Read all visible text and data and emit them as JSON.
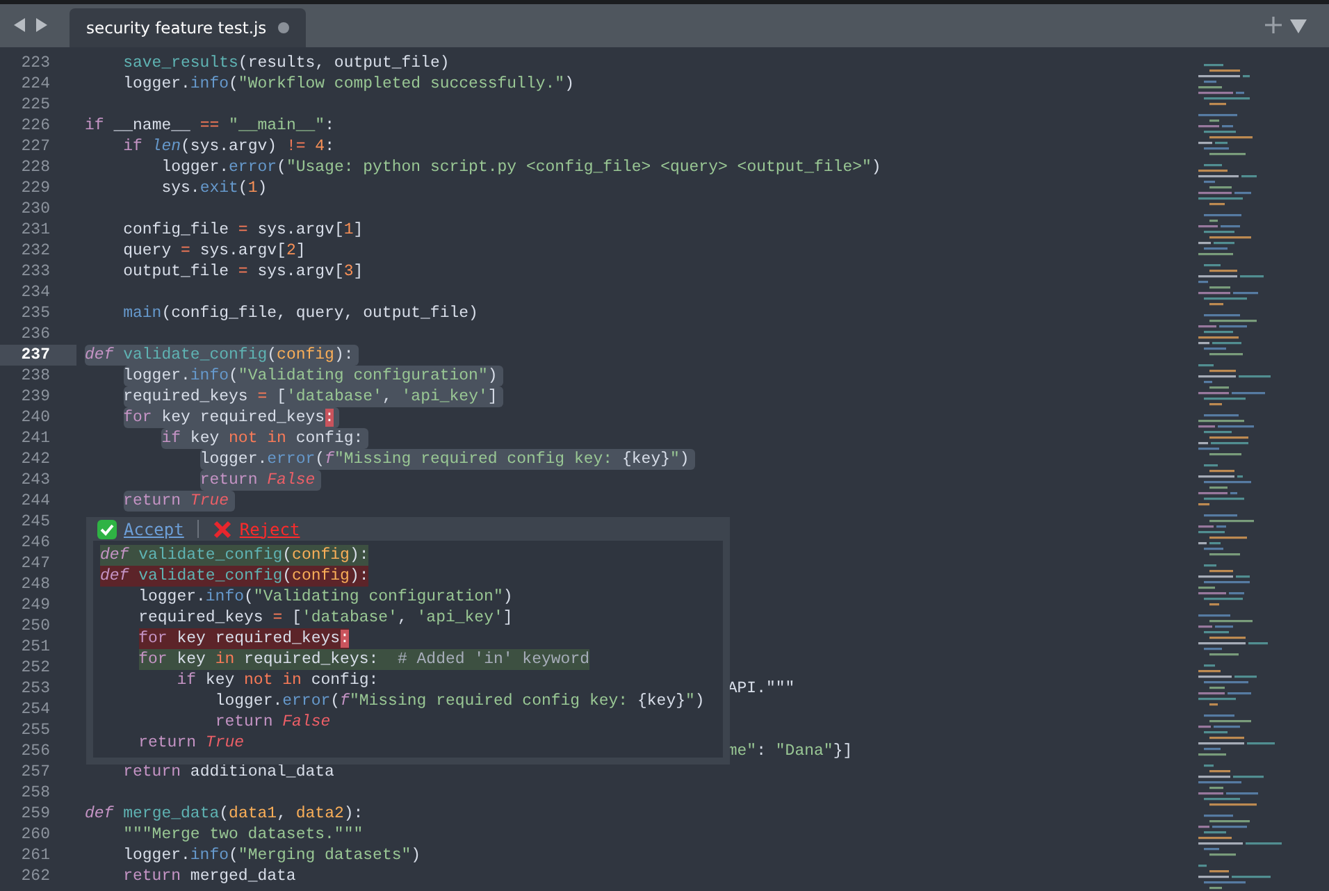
{
  "tabs": [
    {
      "title": "security feature test.js",
      "selected": true,
      "modified": true
    }
  ],
  "lines": [
    {
      "number": "223",
      "tokens": [
        {
          "kind": "fn",
          "text": "    save_results"
        },
        {
          "kind": "p",
          "text": "(results, output_file)"
        }
      ]
    },
    {
      "number": "224",
      "tokens": [
        {
          "kind": "p",
          "text": "    logger."
        },
        {
          "kind": "m",
          "text": "info"
        },
        {
          "kind": "p",
          "text": "("
        },
        {
          "kind": "s",
          "text": "\"Workflow completed successfully.\""
        },
        {
          "kind": "p",
          "text": ")"
        }
      ]
    },
    {
      "number": "225"
    },
    {
      "number": "226",
      "tokens": [
        {
          "kind": "kw",
          "text": "if"
        },
        {
          "kind": "p",
          "text": " __name__ "
        },
        {
          "kind": "op",
          "text": "=="
        },
        {
          "kind": "s",
          "text": " \"__main__\""
        },
        {
          "kind": "p",
          "text": ":"
        }
      ]
    },
    {
      "number": "227",
      "tokens": [
        {
          "kind": "kw",
          "text": "    if"
        },
        {
          "kind": "mi",
          "text": " len"
        },
        {
          "kind": "p",
          "text": "(sys.argv) "
        },
        {
          "kind": "op",
          "text": "!="
        },
        {
          "kind": "n",
          "text": " 4"
        },
        {
          "kind": "p",
          "text": ":"
        }
      ]
    },
    {
      "number": "228",
      "tokens": [
        {
          "kind": "p",
          "text": "        logger."
        },
        {
          "kind": "m",
          "text": "error"
        },
        {
          "kind": "p",
          "text": "("
        },
        {
          "kind": "s",
          "text": "\"Usage: python script.py <config_file> <query> <output_file>\""
        },
        {
          "kind": "p",
          "text": ")"
        }
      ]
    },
    {
      "number": "229",
      "tokens": [
        {
          "kind": "p",
          "text": "        sys."
        },
        {
          "kind": "m",
          "text": "exit"
        },
        {
          "kind": "p",
          "text": "("
        },
        {
          "kind": "n",
          "text": "1"
        },
        {
          "kind": "p",
          "text": ")"
        }
      ]
    },
    {
      "number": "230"
    },
    {
      "number": "231",
      "tokens": [
        {
          "kind": "p",
          "text": "    config_file "
        },
        {
          "kind": "op",
          "text": "="
        },
        {
          "kind": "p",
          "text": " sys.argv["
        },
        {
          "kind": "n",
          "text": "1"
        },
        {
          "kind": "p",
          "text": "]"
        }
      ]
    },
    {
      "number": "232",
      "tokens": [
        {
          "kind": "p",
          "text": "    query "
        },
        {
          "kind": "op",
          "text": "="
        },
        {
          "kind": "p",
          "text": " sys.argv["
        },
        {
          "kind": "n",
          "text": "2"
        },
        {
          "kind": "p",
          "text": "]"
        }
      ]
    },
    {
      "number": "233",
      "tokens": [
        {
          "kind": "p",
          "text": "    output_file "
        },
        {
          "kind": "op",
          "text": "="
        },
        {
          "kind": "p",
          "text": " sys.argv["
        },
        {
          "kind": "n",
          "text": "3"
        },
        {
          "kind": "p",
          "text": "]"
        }
      ]
    },
    {
      "number": "234"
    },
    {
      "number": "235",
      "tokens": [
        {
          "kind": "m",
          "text": "    main"
        },
        {
          "kind": "p",
          "text": "(config_file, query, output_file)"
        }
      ]
    },
    {
      "number": "236"
    },
    {
      "number": "237",
      "current": true,
      "selected": true,
      "tokens": [
        {
          "kind": "def",
          "text": "def"
        },
        {
          "kind": "fn",
          "text": " validate_config"
        },
        {
          "kind": "p",
          "text": "("
        },
        {
          "kind": "arg",
          "text": "config"
        },
        {
          "kind": "p",
          "text": "):"
        }
      ]
    },
    {
      "number": "238",
      "selected": true,
      "tokens": [
        {
          "kind": "p",
          "text": "    logger."
        },
        {
          "kind": "m",
          "text": "info"
        },
        {
          "kind": "p",
          "text": "("
        },
        {
          "kind": "s",
          "text": "\"Validating configuration\""
        },
        {
          "kind": "p",
          "text": ")"
        }
      ]
    },
    {
      "number": "239",
      "selected": true,
      "tokens": [
        {
          "kind": "p",
          "text": "    required_keys "
        },
        {
          "kind": "op",
          "text": "="
        },
        {
          "kind": "p",
          "text": " ["
        },
        {
          "kind": "s",
          "text": "'database'"
        },
        {
          "kind": "p",
          "text": ", "
        },
        {
          "kind": "s",
          "text": "'api_key'"
        },
        {
          "kind": "p",
          "text": "]"
        }
      ]
    },
    {
      "number": "240",
      "selected": true,
      "tokens": [
        {
          "kind": "kw",
          "text": "    for"
        },
        {
          "kind": "p",
          "text": " key required_keys"
        },
        {
          "kind": "err",
          "text": ":"
        }
      ]
    },
    {
      "number": "241",
      "selected": true,
      "tokens": [
        {
          "kind": "kw",
          "text": "        if"
        },
        {
          "kind": "p",
          "text": " key "
        },
        {
          "kind": "op",
          "text": "not in"
        },
        {
          "kind": "p",
          "text": " config:"
        }
      ]
    },
    {
      "number": "242",
      "selected": true,
      "tokens": [
        {
          "kind": "p",
          "text": "            logger."
        },
        {
          "kind": "m",
          "text": "error"
        },
        {
          "kind": "p",
          "text": "("
        },
        {
          "kind": "fp",
          "text": "f"
        },
        {
          "kind": "s",
          "text": "\"Missing required config key: "
        },
        {
          "kind": "p",
          "text": "{key}"
        },
        {
          "kind": "s",
          "text": "\""
        },
        {
          "kind": "p",
          "text": ")"
        }
      ]
    },
    {
      "number": "243",
      "selected": true,
      "tokens": [
        {
          "kind": "kw",
          "text": "            return"
        },
        {
          "kind": "c",
          "text": " False"
        }
      ]
    },
    {
      "number": "244",
      "selected": true,
      "tokens": [
        {
          "kind": "kw",
          "text": "    return"
        },
        {
          "kind": "c",
          "text": " True"
        }
      ]
    },
    {
      "number": "245"
    },
    {
      "number": "246"
    },
    {
      "number": "247"
    },
    {
      "number": "248"
    },
    {
      "number": "249"
    },
    {
      "number": "250"
    },
    {
      "number": "251"
    },
    {
      "number": "252"
    },
    {
      "number": "253",
      "tokens": [
        {
          "kind": "p",
          "text": "                                                                   API.\"\"\""
        }
      ]
    },
    {
      "number": "254"
    },
    {
      "number": "255"
    },
    {
      "number": "256",
      "tokens": [
        {
          "kind": "s",
          "text": "                                                                   me\""
        },
        {
          "kind": "p",
          "text": ": "
        },
        {
          "kind": "s",
          "text": "\"Dana\""
        },
        {
          "kind": "p",
          "text": "}]"
        }
      ]
    },
    {
      "number": "257",
      "tokens": [
        {
          "kind": "kw",
          "text": "    return"
        },
        {
          "kind": "p",
          "text": " additional_data"
        }
      ]
    },
    {
      "number": "258"
    },
    {
      "number": "259",
      "tokens": [
        {
          "kind": "def",
          "text": "def"
        },
        {
          "kind": "fn",
          "text": " merge_data"
        },
        {
          "kind": "p",
          "text": "("
        },
        {
          "kind": "arg",
          "text": "data1"
        },
        {
          "kind": "p",
          "text": ", "
        },
        {
          "kind": "arg",
          "text": "data2"
        },
        {
          "kind": "p",
          "text": "):"
        }
      ]
    },
    {
      "number": "260",
      "tokens": [
        {
          "kind": "s",
          "text": "    \"\"\"Merge two datasets.\"\"\""
        }
      ]
    },
    {
      "number": "261",
      "tokens": [
        {
          "kind": "p",
          "text": "    logger."
        },
        {
          "kind": "m",
          "text": "info"
        },
        {
          "kind": "p",
          "text": "("
        },
        {
          "kind": "s",
          "text": "\"Merging datasets\""
        },
        {
          "kind": "p",
          "text": ")"
        }
      ]
    },
    {
      "number": "262",
      "tokens": [
        {
          "kind": "kw",
          "text": "    return"
        },
        {
          "kind": "p",
          "text": " merged_data"
        }
      ]
    }
  ],
  "diff_popup": {
    "actions": [
      {
        "kind": "accept",
        "label": "Accept"
      },
      {
        "kind": "reject",
        "label": "Reject"
      }
    ],
    "lines": [
      {
        "kind": "added",
        "tokens": [
          {
            "kind": "def",
            "text": "def"
          },
          {
            "kind": "fn",
            "text": " validate_config"
          },
          {
            "kind": "p",
            "text": "("
          },
          {
            "kind": "arg",
            "text": "config"
          },
          {
            "kind": "p",
            "text": "):"
          }
        ]
      },
      {
        "kind": "removed",
        "tokens": [
          {
            "kind": "def",
            "text": "def"
          },
          {
            "kind": "fn",
            "text": " validate_config"
          },
          {
            "kind": "p",
            "text": "("
          },
          {
            "kind": "arg",
            "text": "config"
          },
          {
            "kind": "p",
            "text": "):"
          }
        ]
      },
      {
        "kind": "normal",
        "tokens": [
          {
            "kind": "p",
            "text": "    logger."
          },
          {
            "kind": "m",
            "text": "info"
          },
          {
            "kind": "p",
            "text": "("
          },
          {
            "kind": "s",
            "text": "\"Validating configuration\""
          },
          {
            "kind": "p",
            "text": ")"
          }
        ]
      },
      {
        "kind": "normal",
        "tokens": [
          {
            "kind": "p",
            "text": "    required_keys "
          },
          {
            "kind": "op",
            "text": "="
          },
          {
            "kind": "p",
            "text": " ["
          },
          {
            "kind": "s",
            "text": "'database'"
          },
          {
            "kind": "p",
            "text": ", "
          },
          {
            "kind": "s",
            "text": "'api_key'"
          },
          {
            "kind": "p",
            "text": "]"
          }
        ]
      },
      {
        "kind": "removed",
        "tokens": [
          {
            "kind": "kw",
            "text": "    for"
          },
          {
            "kind": "p",
            "text": " key required_keys"
          },
          {
            "kind": "err",
            "text": ":"
          }
        ]
      },
      {
        "kind": "added",
        "tokens": [
          {
            "kind": "kw",
            "text": "    for"
          },
          {
            "kind": "p",
            "text": " key "
          },
          {
            "kind": "op",
            "text": "in"
          },
          {
            "kind": "p",
            "text": " required_keys:  "
          },
          {
            "kind": "cm",
            "text": "# Added 'in' keyword"
          }
        ]
      },
      {
        "kind": "normal",
        "tokens": [
          {
            "kind": "kw",
            "text": "        if"
          },
          {
            "kind": "p",
            "text": " key "
          },
          {
            "kind": "op",
            "text": "not in"
          },
          {
            "kind": "p",
            "text": " config:"
          }
        ]
      },
      {
        "kind": "normal",
        "tokens": [
          {
            "kind": "p",
            "text": "            logger."
          },
          {
            "kind": "m",
            "text": "error"
          },
          {
            "kind": "p",
            "text": "("
          },
          {
            "kind": "fp",
            "text": "f"
          },
          {
            "kind": "s",
            "text": "\"Missing required config key: "
          },
          {
            "kind": "p",
            "text": "{key}"
          },
          {
            "kind": "s",
            "text": "\""
          },
          {
            "kind": "p",
            "text": ")"
          }
        ]
      },
      {
        "kind": "normal",
        "tokens": [
          {
            "kind": "kw",
            "text": "            return"
          },
          {
            "kind": "c",
            "text": " False"
          }
        ]
      },
      {
        "kind": "normal",
        "tokens": [
          {
            "kind": "kw",
            "text": "    return"
          },
          {
            "kind": "c",
            "text": " True"
          }
        ]
      }
    ]
  }
}
